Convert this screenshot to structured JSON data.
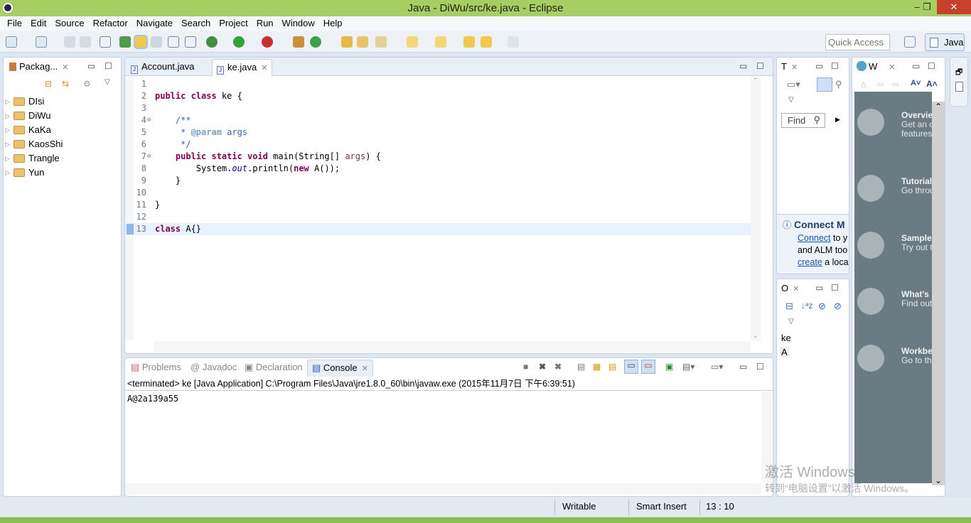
{
  "window": {
    "title": "Java - DiWu/src/ke.java - Eclipse",
    "minimize": "–",
    "restore": "❐",
    "close": "✕"
  },
  "menu": [
    "File",
    "Edit",
    "Source",
    "Refactor",
    "Navigate",
    "Search",
    "Project",
    "Run",
    "Window",
    "Help"
  ],
  "toolbar": {
    "quick_access_placeholder": "Quick Access",
    "perspective": "Java"
  },
  "package_explorer": {
    "title": "Packag...",
    "projects": [
      "DIsi",
      "DiWu",
      "KaKa",
      "KaosShi",
      "Trangle",
      "Yun"
    ]
  },
  "editor": {
    "tabs": [
      {
        "label": "Account.java",
        "active": false
      },
      {
        "label": "ke.java",
        "active": true
      }
    ],
    "lines": [
      "1",
      "2",
      "3",
      "4",
      "5",
      "6",
      "7",
      "8",
      "9",
      "10",
      "11",
      "12",
      "13"
    ],
    "current_line": "13"
  },
  "console": {
    "tabs": [
      "Problems",
      "Javadoc",
      "Declaration",
      "Console"
    ],
    "header": "<terminated> ke [Java Application] C:\\Program Files\\Java\\jre1.8.0_60\\bin\\javaw.exe (2015年11月7日 下午6:39:51)",
    "output": "A@2a139a55"
  },
  "task_list": {
    "title": "T",
    "find_placeholder": "Find",
    "connect_title": "Connect M",
    "connect_link": "Connect",
    "connect_text1": " to y",
    "connect_text2": "and ALM too",
    "create_link": "create",
    "connect_text3": " a loca"
  },
  "outline": {
    "title": "O",
    "items": [
      "ke",
      "A"
    ]
  },
  "welcome": {
    "title": "W",
    "items": [
      {
        "title": "Overview",
        "desc": "Get an o\nfeatures"
      },
      {
        "title": "Tutorials",
        "desc": "Go throu"
      },
      {
        "title": "Samples",
        "desc": "Try out t"
      },
      {
        "title": "What's New",
        "desc": "Find out"
      },
      {
        "title": "Workbench",
        "desc": "Go to the"
      }
    ]
  },
  "status": {
    "writable": "Writable",
    "insert_mode": "Smart Insert",
    "position": "13 : 10"
  },
  "watermark": {
    "line1": "激活 Windows",
    "line2": "转到“电脑设置”以激活 Windows。"
  }
}
